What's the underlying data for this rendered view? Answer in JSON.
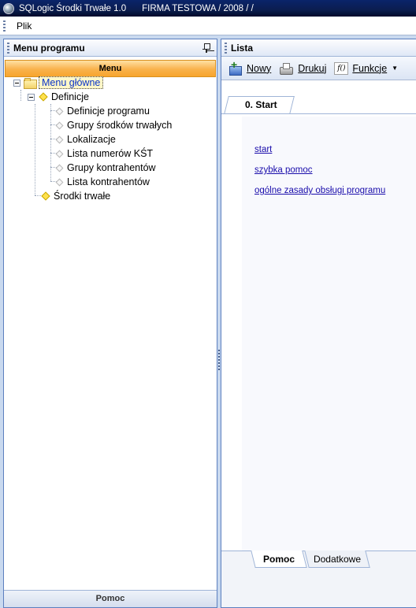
{
  "window": {
    "title": "SQLogic Środki Trwałe 1.0",
    "context": "FIRMA TESTOWA / 2008 /  /"
  },
  "menubar": {
    "items": [
      {
        "label": "Plik"
      }
    ]
  },
  "left_panel": {
    "title": "Menu programu",
    "section_header": "Menu",
    "tree": {
      "root": "Menu główne",
      "definicje": "Definicje",
      "children": [
        "Definicje programu",
        "Grupy środków trwałych",
        "Lokalizacje",
        "Lista numerów KŚT",
        "Grupy kontrahentów",
        "Lista kontrahentów"
      ],
      "srodki": "Środki trwałe"
    },
    "bottom_tab": "Pomoc"
  },
  "right_panel": {
    "title": "Lista",
    "toolbar": {
      "new_label": "Nowy",
      "print_label": "Drukuj",
      "functions_label": "Funkcje"
    },
    "tab": {
      "label": "0. Start"
    },
    "links": [
      "start",
      "szybka pomoc",
      "ogólne zasady obsługi programu"
    ],
    "bottom_tabs": [
      "Pomoc",
      "Dodatkowe"
    ]
  }
}
